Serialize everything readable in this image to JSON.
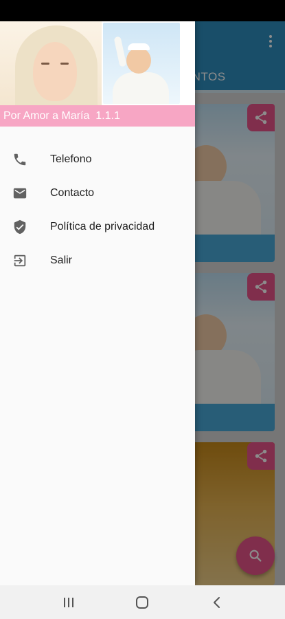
{
  "app": {
    "tab_label": "VENTOS",
    "accent_colors": {
      "toolbar": "#2f8fbf",
      "pink": "#e9558a",
      "header_label_bg": "#f7a6c4"
    }
  },
  "drawer": {
    "header_text": "Por Amor a María  1.1.1",
    "items": [
      {
        "label": "Telefono",
        "icon": "phone-icon"
      },
      {
        "label": "Contacto",
        "icon": "mail-icon"
      },
      {
        "label": "Política de privacidad",
        "icon": "shield-check-icon"
      },
      {
        "label": "Salir",
        "icon": "exit-icon"
      }
    ]
  },
  "nav": {
    "buttons": [
      "recents-icon",
      "home-icon",
      "back-icon"
    ]
  }
}
